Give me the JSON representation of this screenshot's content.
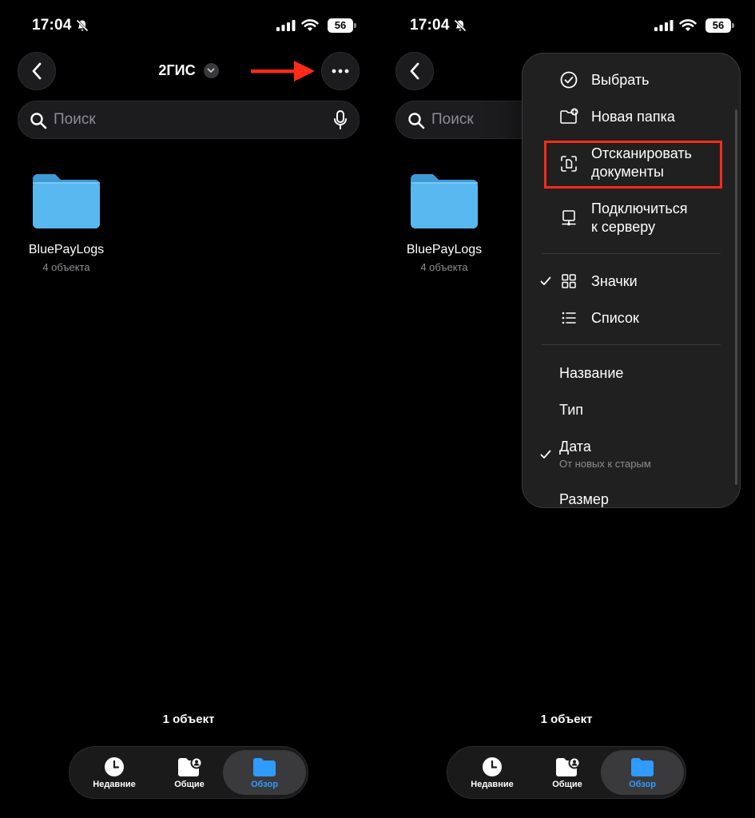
{
  "colors": {
    "accent_blue": "#2f9bff",
    "highlight_red": "#ff2a1a",
    "folder_blue": "#5ab8f0"
  },
  "status_bar": {
    "time": "17:04",
    "battery": "56"
  },
  "nav": {
    "title": "2ГИС"
  },
  "search": {
    "placeholder": "Поиск"
  },
  "folder": {
    "name": "BluePayLogs",
    "count": "4 объекта"
  },
  "footer": {
    "items_count": "1 объект"
  },
  "tabs": [
    {
      "label": "Недавние",
      "icon": "clock-icon"
    },
    {
      "label": "Общие",
      "icon": "shared-folder-icon"
    },
    {
      "label": "Обзор",
      "icon": "folder-icon",
      "selected": true
    }
  ],
  "menu": {
    "actions": [
      {
        "label": "Выбрать",
        "icon": "checkmark-circle-icon"
      },
      {
        "label": "Новая папка",
        "icon": "new-folder-icon"
      },
      {
        "label_line1": "Отсканировать",
        "label_line2": "документы",
        "icon": "scan-document-icon",
        "highlighted": true
      },
      {
        "label_line1": "Подключиться",
        "label_line2": "к серверу",
        "icon": "server-icon"
      }
    ],
    "view": [
      {
        "label": "Значки",
        "icon": "grid-icon",
        "checked": true
      },
      {
        "label": "Список",
        "icon": "list-icon",
        "checked": false
      }
    ],
    "sort": [
      {
        "label": "Название"
      },
      {
        "label": "Тип"
      },
      {
        "label": "Дата",
        "sublabel": "От новых к старым",
        "checked": true
      },
      {
        "label": "Размер"
      }
    ]
  }
}
